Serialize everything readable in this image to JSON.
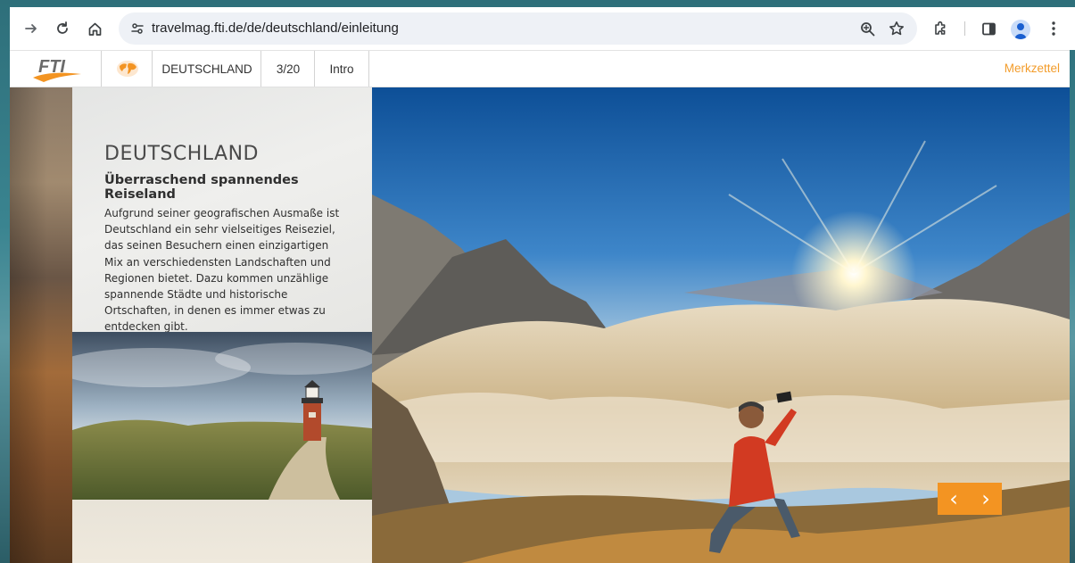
{
  "browser": {
    "url": "travelmag.fti.de/de/deutschland/einleitung",
    "icons": [
      "forward-icon",
      "reload-icon",
      "home-icon",
      "site-info-icon",
      "zoom-icon",
      "bookmark-star-icon",
      "extensions-icon",
      "side-panel-icon",
      "profile-icon",
      "menu-kebab-icon"
    ]
  },
  "header": {
    "logo": "FTI",
    "country": "DEUTSCHLAND",
    "page_indicator": "3/20",
    "section": "Intro",
    "merkzettel": "Merkzettel"
  },
  "panel": {
    "title": "DEUTSCHLAND",
    "subtitle": "Überraschend spannendes Reiseland",
    "body": "Aufgrund seiner geografischen Ausmaße ist Deutschland ein sehr vielseitiges Reiseziel, das seinen Besuchern einen einzigartigen Mix an verschiedensten Landschaften und Regionen bietet. Dazu kommen unzählige spannende Städte und historische Ortschaften, in denen es immer etwas zu entdecken gibt."
  },
  "slider": {
    "prev": "‹",
    "next": "›"
  },
  "colors": {
    "accent": "#f39422",
    "merkzettel": "#f39c2b",
    "header_bg": "#ffffff"
  }
}
